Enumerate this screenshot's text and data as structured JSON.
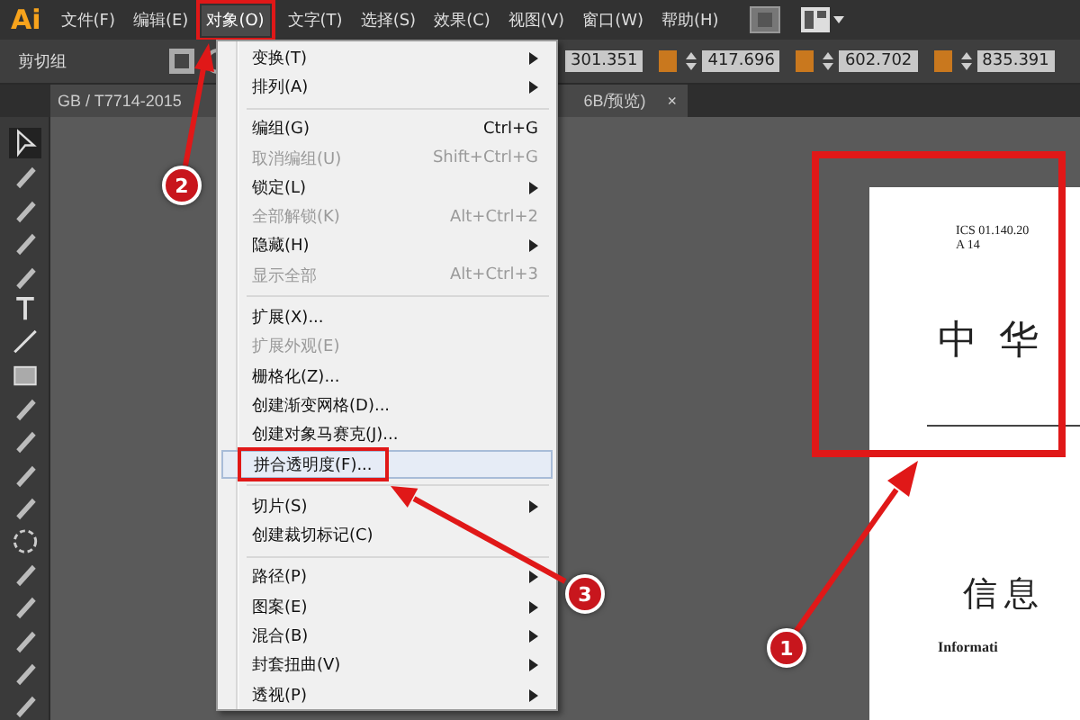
{
  "app": {
    "logo": "Ai"
  },
  "menubar": [
    {
      "label": "文件(F)",
      "selected": false
    },
    {
      "label": "编辑(E)",
      "selected": false
    },
    {
      "label": "对象(O)",
      "selected": true
    },
    {
      "label": "文字(T)",
      "selected": false
    },
    {
      "label": "选择(S)",
      "selected": false
    },
    {
      "label": "效果(C)",
      "selected": false
    },
    {
      "label": "视图(V)",
      "selected": false
    },
    {
      "label": "窗口(W)",
      "selected": false
    },
    {
      "label": "帮助(H)",
      "selected": false
    }
  ],
  "control_bar": {
    "label": "剪切组",
    "fields": [
      {
        "value": "301.351"
      },
      {
        "value": "417.696"
      },
      {
        "value": "602.702"
      },
      {
        "value": "835.391"
      }
    ]
  },
  "document_tab": {
    "title_start": "GB / T7714-2015",
    "title_end": "6B/预览)",
    "close": "×"
  },
  "tools": [
    {
      "selected": true
    },
    {
      "selected": false
    },
    {
      "selected": false
    },
    {
      "selected": false
    },
    {
      "selected": false
    },
    {
      "selected": false
    },
    {
      "selected": false
    },
    {
      "selected": false
    },
    {
      "selected": false
    },
    {
      "selected": false
    },
    {
      "selected": false
    },
    {
      "selected": false
    },
    {
      "selected": false
    },
    {
      "selected": false
    },
    {
      "selected": false
    },
    {
      "selected": false
    },
    {
      "selected": false
    },
    {
      "selected": false
    }
  ],
  "menu": [
    {
      "kind": "item",
      "label": "变换(T)",
      "submenu": true,
      "disabled": false,
      "selected": false
    },
    {
      "kind": "item",
      "label": "排列(A)",
      "submenu": true,
      "disabled": false,
      "selected": false
    },
    {
      "kind": "separator"
    },
    {
      "kind": "item",
      "label": "编组(G)",
      "shortcut": "Ctrl+G",
      "submenu": false,
      "disabled": false,
      "selected": false
    },
    {
      "kind": "item",
      "label": "取消编组(U)",
      "shortcut": "Shift+Ctrl+G",
      "submenu": false,
      "disabled": true,
      "selected": false
    },
    {
      "kind": "item",
      "label": "锁定(L)",
      "submenu": true,
      "disabled": false,
      "selected": false
    },
    {
      "kind": "item",
      "label": "全部解锁(K)",
      "shortcut": "Alt+Ctrl+2",
      "submenu": false,
      "disabled": true,
      "selected": false
    },
    {
      "kind": "item",
      "label": "隐藏(H)",
      "submenu": true,
      "disabled": false,
      "selected": false
    },
    {
      "kind": "item",
      "label": "显示全部",
      "shortcut": "Alt+Ctrl+3",
      "submenu": false,
      "disabled": true,
      "selected": false
    },
    {
      "kind": "separator"
    },
    {
      "kind": "item",
      "label": "扩展(X)...",
      "submenu": false,
      "disabled": false,
      "selected": false
    },
    {
      "kind": "item",
      "label": "扩展外观(E)",
      "submenu": false,
      "disabled": true,
      "selected": false
    },
    {
      "kind": "item",
      "label": "栅格化(Z)...",
      "submenu": false,
      "disabled": false,
      "selected": false
    },
    {
      "kind": "item",
      "label": "创建渐变网格(D)...",
      "submenu": false,
      "disabled": false,
      "selected": false
    },
    {
      "kind": "item",
      "label": "创建对象马赛克(J)...",
      "submenu": false,
      "disabled": false,
      "selected": false
    },
    {
      "kind": "item",
      "label": "拼合透明度(F)...",
      "submenu": false,
      "disabled": false,
      "selected": true
    },
    {
      "kind": "separator"
    },
    {
      "kind": "item",
      "label": "切片(S)",
      "submenu": true,
      "disabled": false,
      "selected": false
    },
    {
      "kind": "item",
      "label": "创建裁切标记(C)",
      "submenu": false,
      "disabled": false,
      "selected": false
    },
    {
      "kind": "separator"
    },
    {
      "kind": "item",
      "label": "路径(P)",
      "submenu": true,
      "disabled": false,
      "selected": false
    },
    {
      "kind": "item",
      "label": "图案(E)",
      "submenu": true,
      "disabled": false,
      "selected": false
    },
    {
      "kind": "item",
      "label": "混合(B)",
      "submenu": true,
      "disabled": false,
      "selected": false
    },
    {
      "kind": "item",
      "label": "封套扭曲(V)",
      "submenu": true,
      "disabled": false,
      "selected": false
    },
    {
      "kind": "item",
      "label": "透视(P)",
      "submenu": true,
      "disabled": false,
      "selected": false
    }
  ],
  "document_page": {
    "ics": "ICS 01.140.20",
    "class_code": "A 14",
    "heading": "中华",
    "subtitle": "信息",
    "english": "Informati"
  },
  "callouts": [
    {
      "number": "1"
    },
    {
      "number": "2"
    },
    {
      "number": "3"
    }
  ]
}
